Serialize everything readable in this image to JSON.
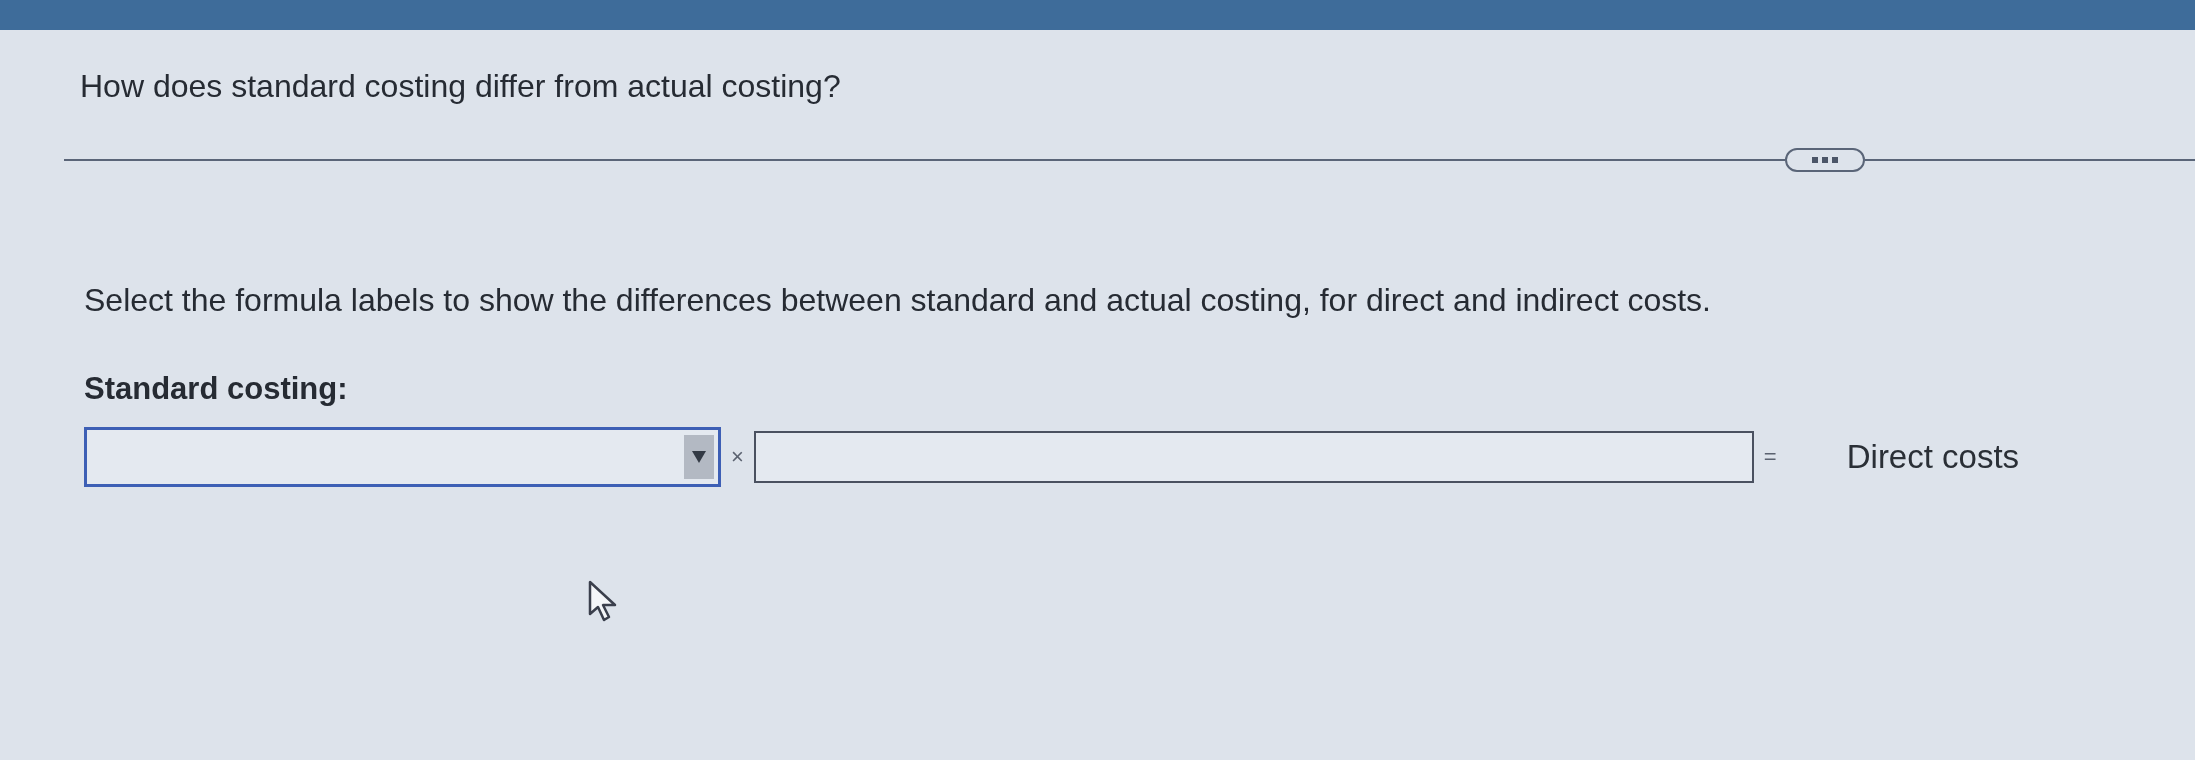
{
  "question": "How does standard costing differ from actual costing?",
  "instruction": "Select the formula labels to show the differences between standard and actual costing, for direct and indirect costs.",
  "section_label": "Standard costing:",
  "formula": [
    {
      "kind": "dropdown",
      "focused": true
    },
    {
      "kind": "operator",
      "text": "×"
    },
    {
      "kind": "input"
    },
    {
      "kind": "operator",
      "text": "="
    },
    {
      "kind": "label",
      "text": "Direct costs"
    }
  ]
}
